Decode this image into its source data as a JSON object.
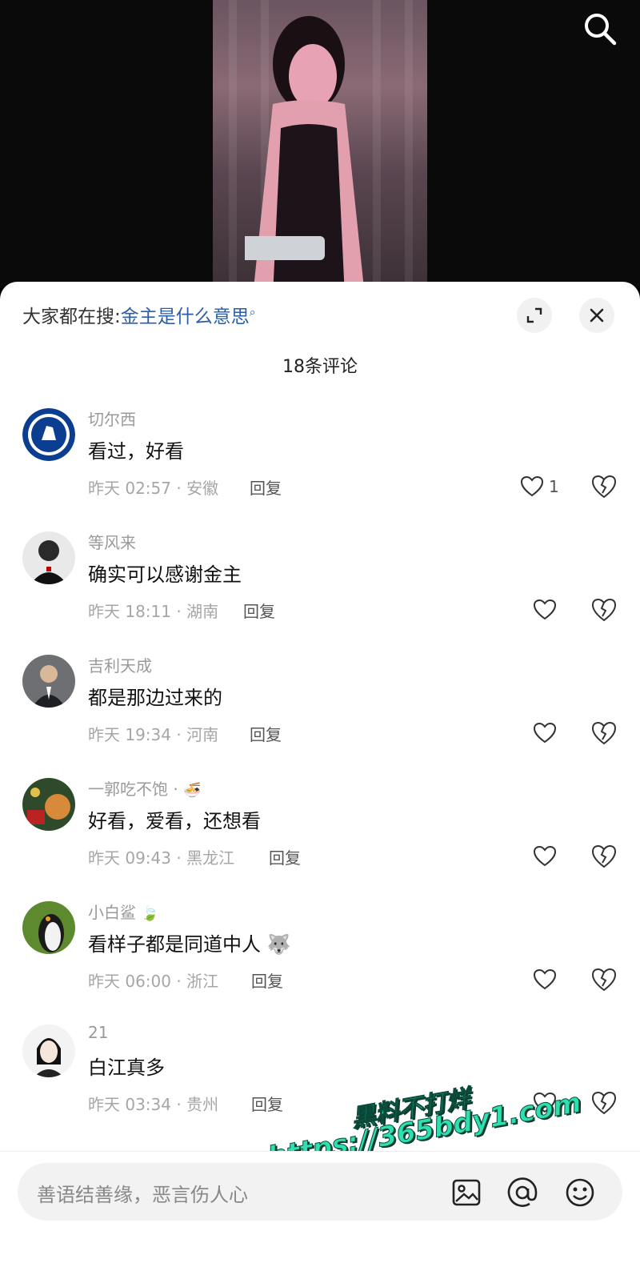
{
  "hot_search": {
    "prefix": "大家都在搜:",
    "query": "金主是什么意思"
  },
  "comment_count_label": "18条评论",
  "comments": [
    {
      "user": "切尔西",
      "text": "看过，好看",
      "meta": "昨天 02:57 · 安徽",
      "reply": "回复",
      "likes": "1"
    },
    {
      "user": "等风来",
      "text": "确实可以感谢金主",
      "meta": "昨天 18:11 · 湖南",
      "reply": "回复",
      "likes": ""
    },
    {
      "user": "吉利天成",
      "text": "都是那边过来的",
      "meta": "昨天 19:34 · 河南",
      "reply": "回复",
      "likes": ""
    },
    {
      "user": "一郭吃不饱 ·",
      "text": "好看，爱看，还想看",
      "meta": "昨天 09:43 · 黑龙江",
      "reply": "回复",
      "likes": ""
    },
    {
      "user": "小白鲨",
      "text": "看样子都是同道中人",
      "meta": "昨天 06:00 · 浙江",
      "reply": "回复",
      "likes": ""
    },
    {
      "user": "21",
      "text": "白江真多",
      "meta": "昨天 03:34 · 贵州",
      "reply": "回复",
      "likes": ""
    }
  ],
  "input": {
    "placeholder": "善语结善缘，恶言伤人心"
  },
  "watermark": {
    "line1": "黑料不打烊",
    "line2": "https://365bdy1.com"
  },
  "colors": {
    "link": "#2b5ea8",
    "watermark": "#2de0b0"
  }
}
